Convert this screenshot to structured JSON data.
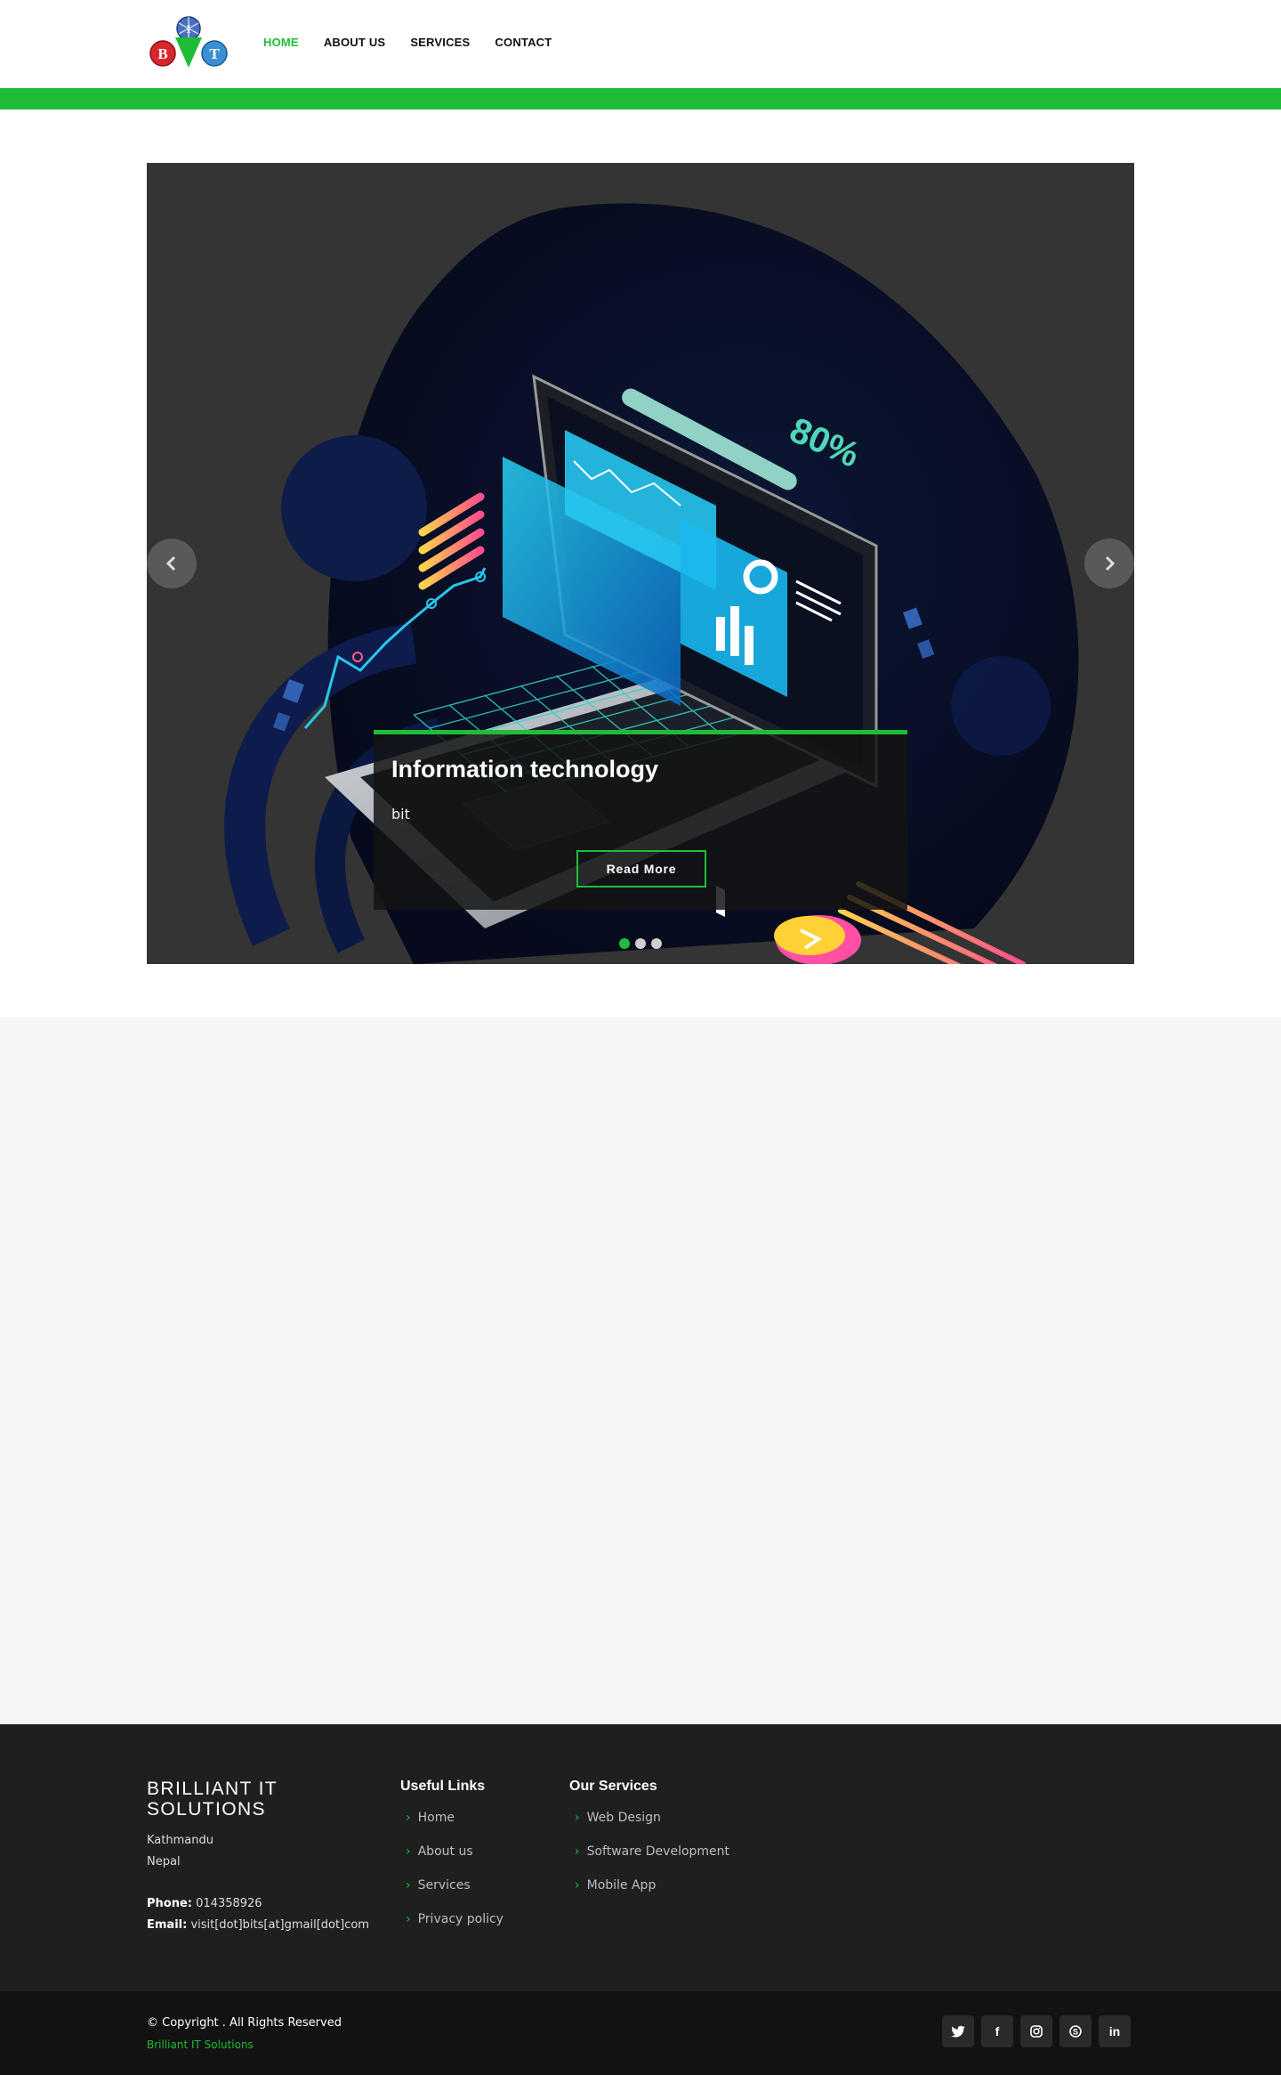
{
  "brand": {
    "logo_letters": [
      "B",
      "I",
      "T"
    ]
  },
  "nav": {
    "items": [
      {
        "label": "HOME",
        "active": true
      },
      {
        "label": "ABOUT US",
        "active": false
      },
      {
        "label": "SERVICES",
        "active": false
      },
      {
        "label": "CONTACT",
        "active": false
      }
    ]
  },
  "colors": {
    "accent": "#1fbd37",
    "footer_bg": "#1f1f1f",
    "bottom_bg": "#121212",
    "section_bg": "#f6f6f6"
  },
  "slider": {
    "prev_icon": "chevron-left-icon",
    "next_icon": "chevron-right-icon",
    "graph_label": "80%",
    "caption": {
      "title": "Information technology",
      "text": "bit",
      "button": "Read More"
    },
    "slide_count": 3,
    "active_slide": 1
  },
  "footer": {
    "brand": "BRILLIANT IT SOLUTIONS",
    "address_line1": "Kathmandu",
    "address_line2": "Nepal",
    "phone_label": "Phone:",
    "phone_value": "014358926",
    "email_label": "Email:",
    "email_value": "visit[dot]bits[at]gmail[dot]com",
    "useful_links": {
      "title": "Useful Links",
      "items": [
        "Home",
        "About us",
        "Services",
        "Privacy policy"
      ]
    },
    "our_services": {
      "title": "Our Services",
      "items": [
        "Web Design",
        "Software Development",
        "Mobile App"
      ]
    }
  },
  "bottom": {
    "copyright": "© Copyright . All Rights Reserved",
    "company_link": "Brilliant IT Solutions",
    "socials": [
      {
        "name": "twitter-icon",
        "glyph": "t"
      },
      {
        "name": "facebook-icon",
        "glyph": "f"
      },
      {
        "name": "instagram-icon",
        "glyph": "◎"
      },
      {
        "name": "skype-icon",
        "glyph": "S"
      },
      {
        "name": "linkedin-icon",
        "glyph": "in"
      }
    ]
  }
}
